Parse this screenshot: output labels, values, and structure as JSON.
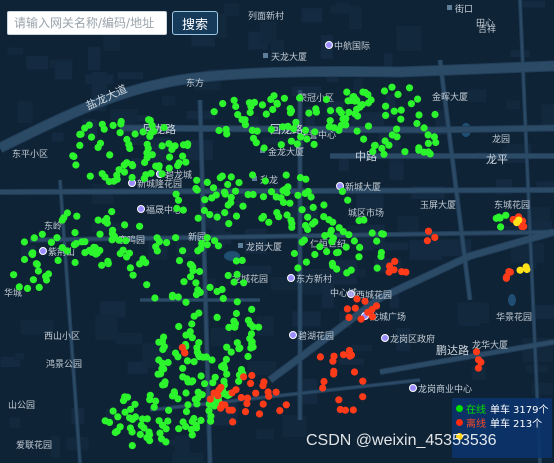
{
  "search": {
    "placeholder": "请输入网关名称/编码/地址",
    "button_label": "搜索"
  },
  "legend": {
    "rows": [
      {
        "status": "在线",
        "type": "单车",
        "count": "3179个",
        "color": "#00e000"
      },
      {
        "status": "离线",
        "type": "单车",
        "count": "213个",
        "color": "#ff2a10"
      },
      {
        "status": "",
        "type": "",
        "count": "",
        "color": "#ffd21a"
      }
    ]
  },
  "watermark": "CSDN @weixin_45353536",
  "colors": {
    "online": "#2df52d",
    "offline": "#ff3b1a",
    "warning": "#ffe21a",
    "water": "#1f4e72",
    "road": "#2b4a66"
  },
  "map": {
    "roads": [
      {
        "name": "盐龙大道"
      },
      {
        "name": "回龙路"
      },
      {
        "name": "回龙路"
      },
      {
        "name": "中路"
      },
      {
        "name": "龙平"
      },
      {
        "name": "鹏达路"
      }
    ],
    "places": [
      {
        "name": "街口",
        "icon": "square"
      },
      {
        "name": "田心"
      },
      {
        "name": "东平小区"
      },
      {
        "name": "龙园"
      },
      {
        "name": "升龙",
        "icon": "square"
      },
      {
        "name": "华城"
      },
      {
        "name": "列面新村"
      },
      {
        "name": "东方"
      },
      {
        "name": "荣冠小区"
      },
      {
        "name": "金晖大厦"
      },
      {
        "name": "中航国际",
        "icon": "pin"
      },
      {
        "name": "天龙大厦",
        "icon": "square"
      },
      {
        "name": "金龙大厦",
        "icon": "square"
      },
      {
        "name": "天誉中心"
      },
      {
        "name": "福晟中心",
        "icon": "pin"
      },
      {
        "name": "新城隆花园",
        "icon": "pin"
      },
      {
        "name": "新城大厦",
        "icon": "pin"
      },
      {
        "name": "城区市场"
      },
      {
        "name": "东岭"
      },
      {
        "name": "山公园"
      },
      {
        "name": "新园"
      },
      {
        "name": "紫荆山",
        "icon": "pin"
      },
      {
        "name": "鹿鸣园"
      },
      {
        "name": "碧龙城",
        "icon": "pin"
      },
      {
        "name": "龙城花园"
      },
      {
        "name": "仁恒世纪"
      },
      {
        "name": "西城花园",
        "icon": "pin"
      },
      {
        "name": "中心城"
      },
      {
        "name": "龙城广场",
        "icon": "pin"
      },
      {
        "name": "吉祥"
      },
      {
        "name": "玉屏大厦"
      },
      {
        "name": "东城花园"
      },
      {
        "name": "东方新村",
        "icon": "pin"
      },
      {
        "name": "龙岗大厦",
        "icon": "square"
      },
      {
        "name": "龙岗区政府",
        "icon": "pin"
      },
      {
        "name": "西山小区"
      },
      {
        "name": "鸿景公园"
      },
      {
        "name": "龙岗商业中心",
        "icon": "pin"
      },
      {
        "name": "龙华大厦"
      },
      {
        "name": "华景花园"
      },
      {
        "name": "碧湖花园",
        "icon": "pin"
      },
      {
        "name": "爱联花园"
      }
    ]
  }
}
